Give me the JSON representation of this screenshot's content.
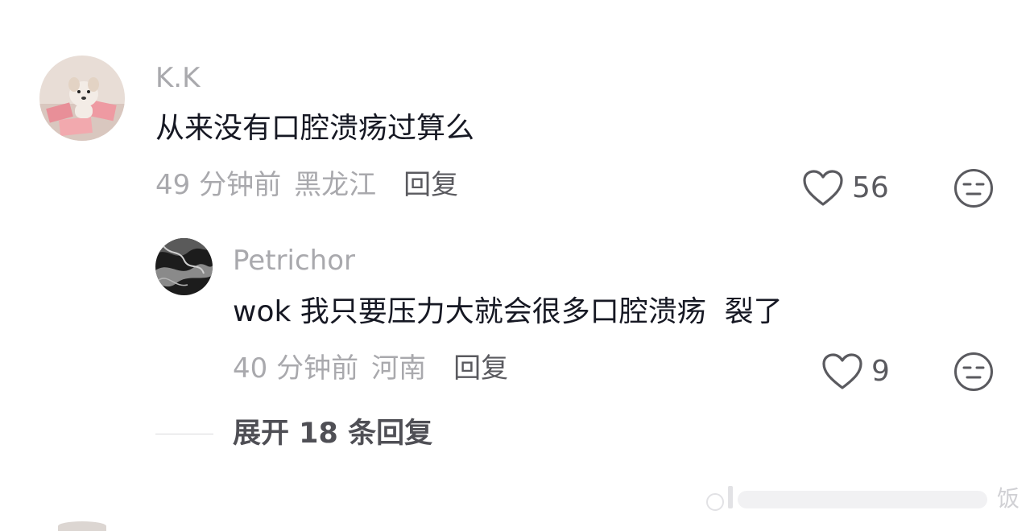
{
  "comments": [
    {
      "username": "K.K",
      "text": "从来没有口腔溃疡过算么",
      "time": "49 分钟前",
      "location": "黑龙江",
      "reply_label": "回复",
      "likes": "56",
      "like_icon": "heart-outline-icon",
      "dislike_icon": "meh-face-icon"
    }
  ],
  "replies": [
    {
      "username": "Petrichor",
      "text": "wok 我只要压力大就会很多口腔溃疡  裂了",
      "time": "40 分钟前",
      "location": "河南",
      "reply_label": "回复",
      "likes": "9",
      "like_icon": "heart-outline-icon",
      "dislike_icon": "meh-face-icon"
    }
  ],
  "expand": {
    "label": "展开 18 条回复"
  },
  "watermark": {
    "text": "饭"
  }
}
